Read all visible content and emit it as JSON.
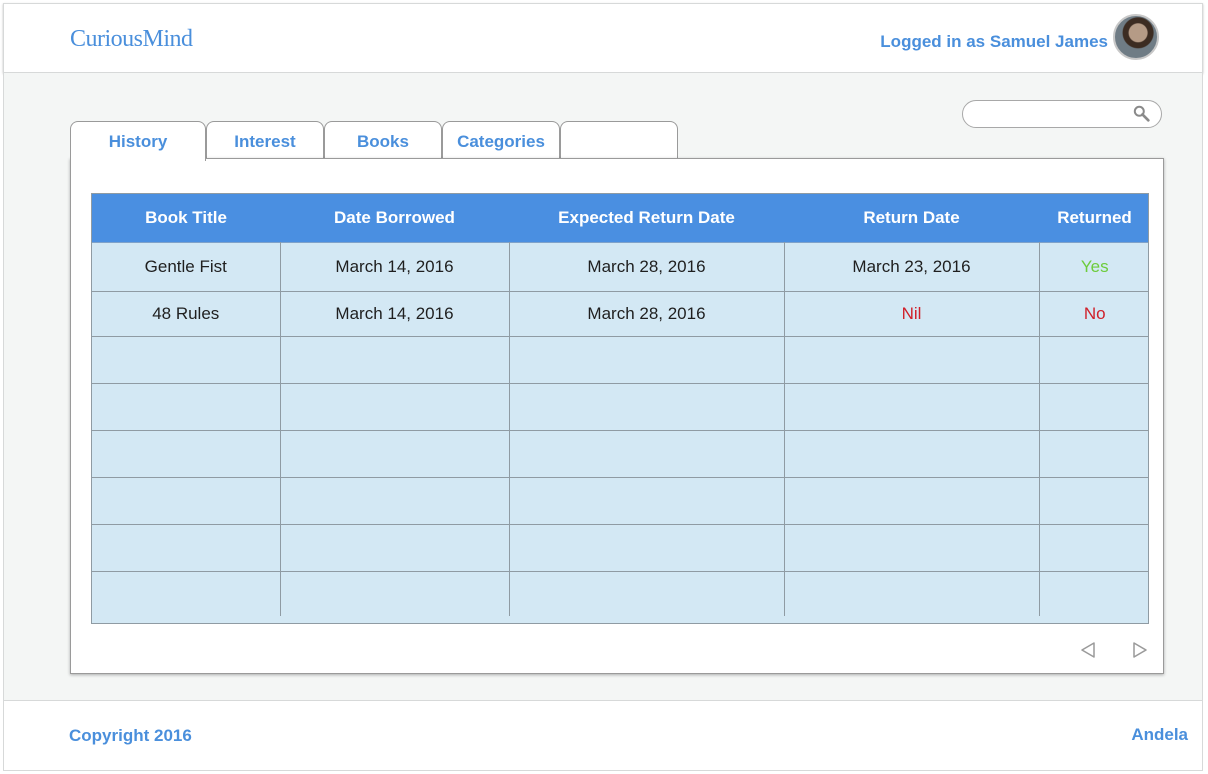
{
  "header": {
    "logo": "CuriousMind",
    "login_text": "Logged in as Samuel James"
  },
  "search": {
    "placeholder": "",
    "value": ""
  },
  "tabs": [
    {
      "label": "History",
      "active": true
    },
    {
      "label": "Interest",
      "active": false
    },
    {
      "label": "Books",
      "active": false
    },
    {
      "label": "Categories",
      "active": false
    },
    {
      "label": "",
      "active": false
    }
  ],
  "table": {
    "columns": [
      "Book Title",
      "Date Borrowed",
      "Expected Return Date",
      "Return Date",
      "Returned"
    ],
    "rows": [
      [
        "Gentle Fist",
        "March 14, 2016",
        "March 28, 2016",
        "March 23, 2016",
        "Yes"
      ],
      [
        "48 Rules",
        "March 14, 2016",
        "March 28, 2016",
        "Nil",
        "No"
      ],
      [
        "",
        "",
        "",
        "",
        ""
      ],
      [
        "",
        "",
        "",
        "",
        ""
      ],
      [
        "",
        "",
        "",
        "",
        ""
      ],
      [
        "",
        "",
        "",
        "",
        ""
      ],
      [
        "",
        "",
        "",
        "",
        ""
      ],
      [
        "",
        "",
        "",
        "",
        ""
      ]
    ]
  },
  "colors": {
    "accent": "#4a8fdc",
    "table_header": "#4a8fe1",
    "table_body": "#d3e8f4",
    "yes": "#6dcc3c",
    "no": "#d0202a"
  },
  "icons": {
    "search": "search-icon",
    "prev": "triangle-left-icon",
    "next": "triangle-right-icon"
  },
  "footer": {
    "copyright": "Copyright 2016",
    "brand": "Andela"
  }
}
